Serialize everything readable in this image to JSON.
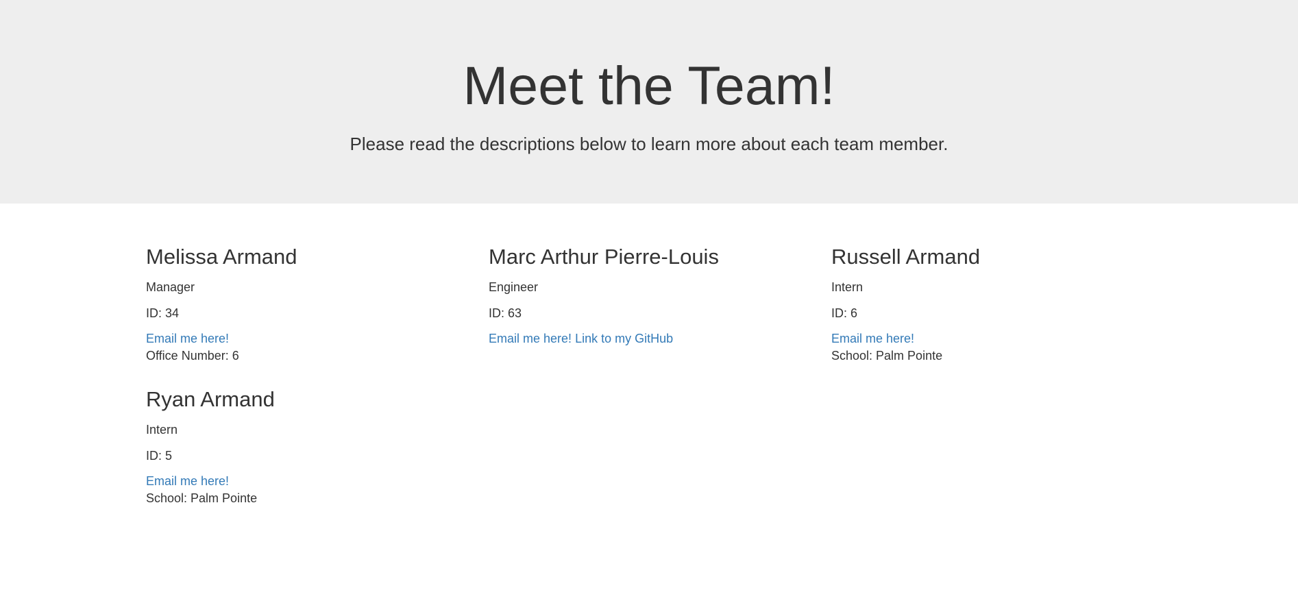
{
  "header": {
    "title": "Meet the Team!",
    "subtitle": "Please read the descriptions below to learn more about each team member."
  },
  "members": [
    {
      "name": "Melissa Armand",
      "role": "Manager",
      "id": "ID: 34",
      "email_label": "Email me here!",
      "extra": "Office Number: 6"
    },
    {
      "name": "Marc Arthur Pierre-Louis",
      "role": "Engineer",
      "id": "ID: 63",
      "email_label": "Email me here!",
      "github_label": "Link to my GitHub"
    },
    {
      "name": "Russell Armand",
      "role": "Intern",
      "id": "ID: 6",
      "email_label": "Email me here!",
      "extra": "School: Palm Pointe"
    },
    {
      "name": "Ryan Armand",
      "role": "Intern",
      "id": "ID: 5",
      "email_label": "Email me here!",
      "extra": "School: Palm Pointe"
    }
  ],
  "colors": {
    "link": "#337ab7",
    "jumbotron_bg": "#eeeeee",
    "text": "#333333"
  }
}
